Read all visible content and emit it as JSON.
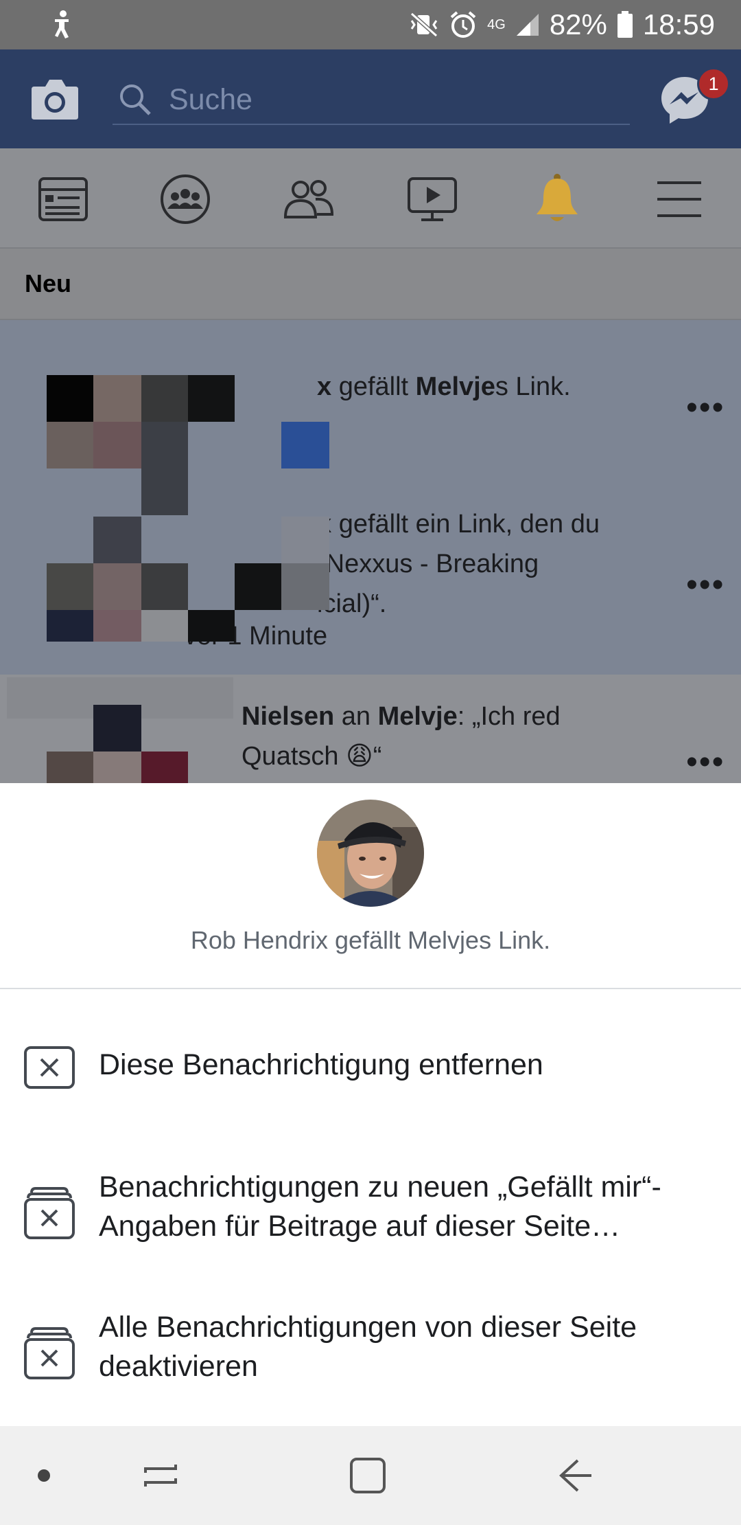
{
  "status_bar": {
    "network": "4G",
    "battery": "82%",
    "time": "18:59"
  },
  "header": {
    "search_placeholder": "Suche",
    "messenger_badge": "1"
  },
  "tabs": [
    "news-feed",
    "groups",
    "friends",
    "watch",
    "notifications",
    "menu"
  ],
  "section": {
    "title": "Neu"
  },
  "notifications": [
    {
      "actor_fragment": "x",
      "text_1": " gefällt ",
      "bold_1": "Melvje",
      "text_2": "s Link."
    },
    {
      "actor_fragment": "x",
      "line_1": " gefällt ein Link, den du",
      "line_2": " „Nexxus - Breaking",
      "line_3": "icial)“.",
      "time": "vor 1 Minute"
    },
    {
      "actor_fragment": "Nielsen",
      "text_1": " an ",
      "bold_1": "Melvje",
      "text_2": ": „Ich red",
      "line_2": "Quatsch",
      "emoji": "😩",
      "line_2_end": "“"
    }
  ],
  "sheet": {
    "subject": "Rob Hendrix gefällt Melvjes Link.",
    "options": [
      {
        "label": "Diese Benachrichtigung entfernen",
        "icon": "close-box-icon"
      },
      {
        "label": "Benachrichtigungen zu neuen „Gefällt mir“-Angaben für Beitrage auf dieser Seite deaktivieren",
        "icon": "notification-stack-off-icon"
      },
      {
        "label": "Alle Benachrichtigungen von dieser Seite deaktivieren",
        "icon": "notification-stack-off-icon"
      }
    ]
  },
  "colors": {
    "brand": "#3b5998",
    "header_dimmed": "#2c3e63",
    "badge": "#e0393e",
    "bell": "#d9a93a"
  }
}
